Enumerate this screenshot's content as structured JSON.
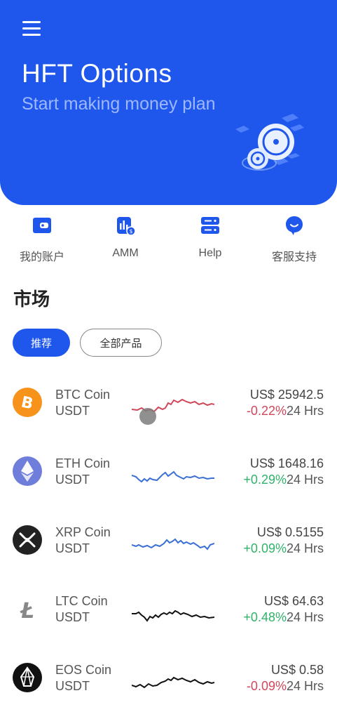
{
  "colors": {
    "brand": "#1f57ec",
    "negative": "#d1475a",
    "positive": "#2fb36b"
  },
  "header": {
    "menu_icon": "hamburger-menu-icon",
    "title": "HFT Options",
    "subtitle": "Start making money plan"
  },
  "quick_actions": [
    {
      "label": "我的账户",
      "icon": "wallet-icon"
    },
    {
      "label": "AMM",
      "icon": "robot-icon"
    },
    {
      "label": "Help",
      "icon": "help-icon"
    },
    {
      "label": "客服支持",
      "icon": "chat-bubble-icon"
    }
  ],
  "market": {
    "title": "市场",
    "tabs": [
      {
        "label": "推荐",
        "active": true
      },
      {
        "label": "全部产品",
        "active": false
      }
    ],
    "coins": [
      {
        "name": "BTC Coin",
        "quote": "USDT",
        "price": "US$ 25942.5",
        "change": "-0.22%",
        "period": "24 Hrs",
        "direction": "down",
        "icon": "bitcoin-icon",
        "spark_color": "#d1475a"
      },
      {
        "name": "ETH Coin",
        "quote": "USDT",
        "price": "US$ 1648.16",
        "change": "+0.29%",
        "period": "24 Hrs",
        "direction": "up",
        "icon": "ethereum-icon",
        "spark_color": "#3a6fd8"
      },
      {
        "name": "XRP Coin",
        "quote": "USDT",
        "price": "US$ 0.5155",
        "change": "+0.09%",
        "period": "24 Hrs",
        "direction": "up",
        "icon": "xrp-icon",
        "spark_color": "#3a6fd8"
      },
      {
        "name": "LTC Coin",
        "quote": "USDT",
        "price": "US$ 64.63",
        "change": "+0.48%",
        "period": "24 Hrs",
        "direction": "up",
        "icon": "litecoin-icon",
        "spark_color": "#111111"
      },
      {
        "name": "EOS Coin",
        "quote": "USDT",
        "price": "US$ 0.58",
        "change": "-0.09%",
        "period": "24 Hrs",
        "direction": "down",
        "icon": "eos-icon",
        "spark_color": "#111111"
      }
    ]
  }
}
